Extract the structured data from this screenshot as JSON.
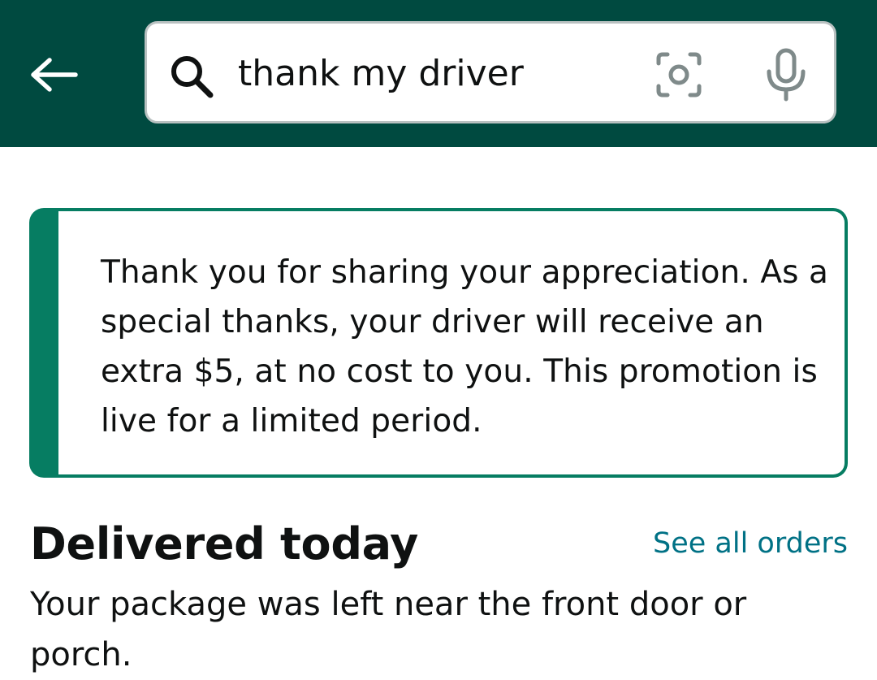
{
  "header": {
    "back_icon": "arrow-left-icon",
    "search": {
      "value": "thank my driver",
      "placeholder": "",
      "search_icon": "magnifier-icon",
      "camera_icon": "camera-lens-icon",
      "mic_icon": "microphone-icon"
    }
  },
  "alert": {
    "message": "Thank you for sharing your appreciation. As a special thanks, your driver will receive an extra $5, at no cost to you. This promotion is live for a limited period.",
    "accent_color": "#067d62"
  },
  "delivery": {
    "title": "Delivered today",
    "see_all_label": "See all orders",
    "status_text": "Your package was left near the front door or porch."
  },
  "colors": {
    "header_bg": "#004a40",
    "link": "#007185",
    "text": "#0f1111"
  }
}
